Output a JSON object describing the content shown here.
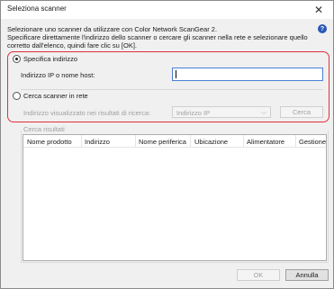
{
  "window": {
    "title": "Seleziona scanner"
  },
  "description": {
    "line1": "Selezionare uno scanner da utilizzare con Color Network ScanGear 2.",
    "line2": "Specificare direttamente l'indirizzo dello scanner o cercare gli scanner nella rete e selezionare quello",
    "line3": "corretto dall'elenco, quindi fare clic su [OK]."
  },
  "specify": {
    "radio_label": "Specifica indirizzo",
    "checked": true,
    "field_label": "Indirizzo IP o nome host:",
    "field_value": ""
  },
  "search": {
    "radio_label": "Cerca scanner in rete",
    "checked": false,
    "address_label": "Indirizzo visualizzato nei risultati di ricerca:",
    "address_value": "Indirizzo IP",
    "search_button": "Cerca"
  },
  "results": {
    "legend": "Cerca risultati",
    "columns": [
      "Nome prodotto",
      "Indirizzo",
      "Nome periferica",
      "Ubicazione",
      "Alimentatore",
      "Gestione c"
    ]
  },
  "buttons": {
    "ok": "OK",
    "cancel": "Annulla"
  },
  "colors": {
    "highlight": "#e0303a",
    "help": "#2b58b8",
    "focus_border": "#4a7fd4"
  }
}
